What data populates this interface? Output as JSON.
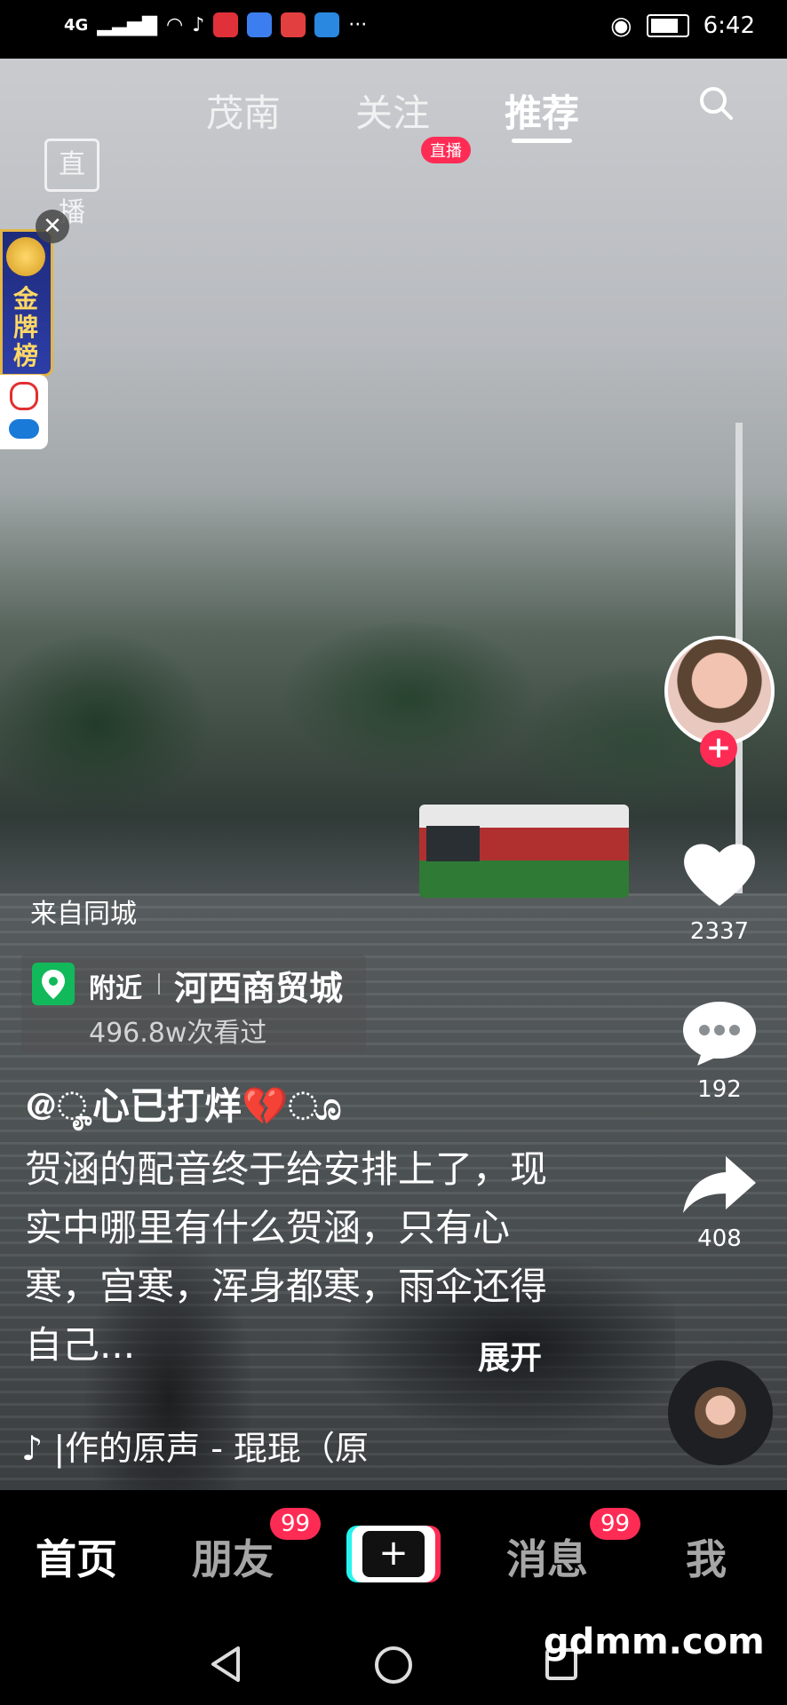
{
  "status_bar": {
    "network": "4G",
    "time": "6:42"
  },
  "top_tabs": {
    "live": "直播",
    "local": "茂南",
    "following": "关注",
    "following_badge": "直播",
    "recommend": "推荐"
  },
  "sticker": {
    "title": "金牌榜"
  },
  "rail": {
    "likes": "2337",
    "comments": "192",
    "shares": "408"
  },
  "post": {
    "from": "来自同城",
    "poi_nearby": "附近",
    "poi_name": "河西商贸城",
    "poi_views": "496.8w次看过",
    "author": "@ೄ心已打烊💔ೂ",
    "description": "贺涵的配音终于给安排上了，现实中哪里有什么贺涵，只有心寒，宫寒，浑身都寒，雨伞还得自己...",
    "expand": "展开",
    "music": "♪ |作的原声 - 琨琨（原"
  },
  "bottom_nav": {
    "home": "首页",
    "friends": "朋友",
    "friends_badge": "99",
    "messages": "消息",
    "messages_badge": "99",
    "me": "我"
  },
  "watermark": "gdmm.com",
  "colors": {
    "accent_red": "#fe2c55",
    "accent_cyan": "#25f4ee",
    "poi_green": "#11b95a"
  }
}
